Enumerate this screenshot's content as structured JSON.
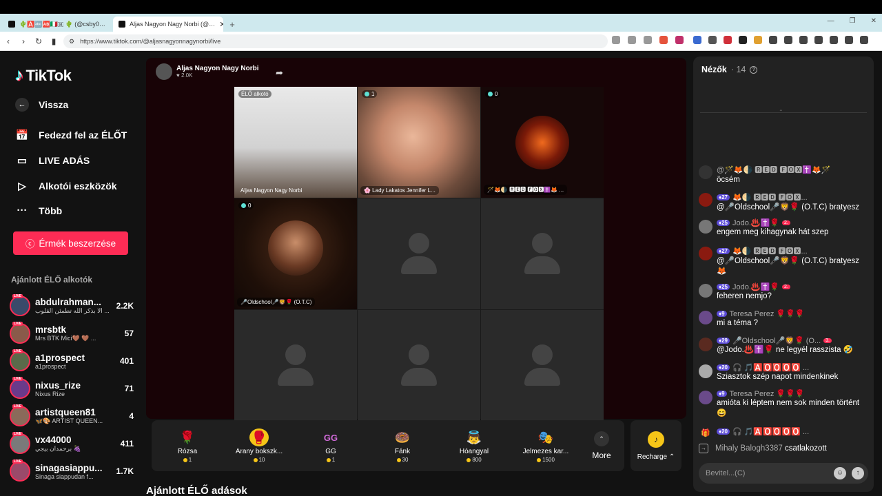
{
  "browser": {
    "tabs": [
      {
        "title": "🌵🅰️🔤🆎🇮🇹🇧 🌵 (@csby0…"
      },
      {
        "title": "Aljas Nagyon Nagy Norbi (@…"
      }
    ],
    "url": "https://www.tiktok.com/@aljasnagyonnagynorbi/live",
    "new_tab": "+",
    "window_controls": [
      "—",
      "❐",
      "✕"
    ]
  },
  "sidebar": {
    "logo": "TikTok",
    "back": "Vissza",
    "nav": [
      {
        "label": "Fedezd fel az ÉLŐT",
        "icon": "calendar-live-icon"
      },
      {
        "label": "LIVE ADÁS",
        "icon": "camera-icon"
      },
      {
        "label": "Alkotói eszközök",
        "icon": "creator-tools-icon"
      },
      {
        "label": "Több",
        "icon": "more-dots-icon"
      }
    ],
    "coins_button": "Érmék beszerzése",
    "recommended_title": "Ajánlott ÉLŐ alkotók",
    "live_badge": "LIVE",
    "creators": [
      {
        "name": "abdulrahman...",
        "sub": "الا بذكر الله تطمئن القلوب ...",
        "count": "2.2K",
        "color": "#3a4a6a"
      },
      {
        "name": "mrsbtk",
        "sub": "Mrs BTK Mici🤎 🤎 ...",
        "count": "57",
        "color": "#8a5a4a"
      },
      {
        "name": "a1prospect",
        "sub": "a1prospect",
        "count": "401",
        "color": "#5a6a4a"
      },
      {
        "name": "nixus_rize",
        "sub": "Nixus Rize",
        "count": "71",
        "color": "#6a3a8a"
      },
      {
        "name": "artistqueen81",
        "sub": "🦋🎨 ARTIST QUEEN...",
        "count": "4",
        "color": "#8a6a5a"
      },
      {
        "name": "vx44000",
        "sub": "برحمدان بيجي 🍇",
        "count": "411",
        "color": "#7a7a7a"
      },
      {
        "name": "sinagasiappu...",
        "sub": "Sinaga siappudan f...",
        "count": "1.7K",
        "color": "#9a4a6a"
      }
    ]
  },
  "stream": {
    "host_name": "Aljas Nagyon Nagy Norbi",
    "host_likes": "♥ 2.0K",
    "tiles": [
      {
        "badge": "ÉLŐ alkotó",
        "label": "Aljas Nagyon Nagy Norbi"
      },
      {
        "badge": "1",
        "label": "🌸 Lady Lakatos Jennifer L..."
      },
      {
        "badge": "0",
        "label": "🪄🦊🌗 🆁🅴🅳 🅵🅾🆇✝️🦊 ..."
      },
      {
        "badge": "0",
        "label": "🎤Oldschool🎤🦁🌹 (O.T.C)"
      }
    ],
    "more_label": "More",
    "recharge_label": "Recharge ⌃"
  },
  "gifts": [
    {
      "name": "Rózsa",
      "price": "1",
      "icon": "🌹",
      "bg": "transparent"
    },
    {
      "name": "Arany bokszk...",
      "price": "10",
      "icon": "🥊",
      "bg": "#f5c518"
    },
    {
      "name": "GG",
      "price": "1",
      "icon": "GG",
      "bg": "transparent"
    },
    {
      "name": "Fánk",
      "price": "30",
      "icon": "🍩",
      "bg": "transparent"
    },
    {
      "name": "Hóangyal",
      "price": "800",
      "icon": "👼",
      "bg": "transparent"
    },
    {
      "name": "Jelmezes kar...",
      "price": "1500",
      "icon": "🎭",
      "bg": "transparent"
    }
  ],
  "recommended_lives_title": "Ajánlott ÉLŐ adások",
  "chat": {
    "viewers_label": "Nézők",
    "viewers_count": "· 14",
    "messages": [
      {
        "head": "@🪄🦊🌗 🆁🅴🅳 🅵🅾🆇✝️🦊🪄",
        "level": "",
        "fan": "",
        "text": "öcsém",
        "avatar": "#333"
      },
      {
        "head": "🦊🌗 🆁🅴🅳 🅵🅾🆇...",
        "level": "27",
        "fan": "",
        "text": "@🎤Oldschool🎤🦁🌹 (O.T.C) bratyesz",
        "avatar": "#8a1a10"
      },
      {
        "head": "Jodo.♨️✝️🌹",
        "level": "25",
        "fan": "2.",
        "text": "engem meg kihagynak hát szep",
        "avatar": "#777"
      },
      {
        "head": "🦊🌗 🆁🅴🅳 🅵🅾🆇...",
        "level": "27",
        "fan": "",
        "text": "@🎤Oldschool🎤🦁🌹 (O.T.C) bratyesz 🦊",
        "avatar": "#8a1a10"
      },
      {
        "head": "Jodo.♨️✝️🌹",
        "level": "25",
        "fan": "2.",
        "text": "feheren nemjo?",
        "avatar": "#777"
      },
      {
        "head": "Teresa Perez 🌹🌹🌹",
        "level": "9",
        "fan": "",
        "text": "mi a téma ?",
        "avatar": "#6a4a8a"
      },
      {
        "head": "🎤Oldschool🎤🦁🌹 (O...",
        "level": "29",
        "fan": "3.",
        "text": "@Jodo.♨️✝️🌹 ne legyél rasszista 🤣",
        "avatar": "#5a2a20"
      },
      {
        "head": "🎧 🎵🅰️🅾️🅾️🅾️🅾️ ...",
        "level": "20",
        "fan": "",
        "text": "Sziasztok szép napot mindenkinek",
        "avatar": "#aaa"
      },
      {
        "head": "Teresa Perez 🌹🌹🌹",
        "level": "9",
        "fan": "",
        "text": "amióta ki léptem nem sok minden történt 😄",
        "avatar": "#6a4a8a"
      },
      {
        "head": "🎧 🎵🅰️🅾️🅾️🅾️🅾️ ...",
        "level": "20",
        "fan": "",
        "text": "",
        "avatar": "#333"
      }
    ],
    "joined_user": "Mihaly Balogh3387",
    "joined_text": "csatlakozott",
    "input_placeholder": "Bevitel...(C)"
  }
}
